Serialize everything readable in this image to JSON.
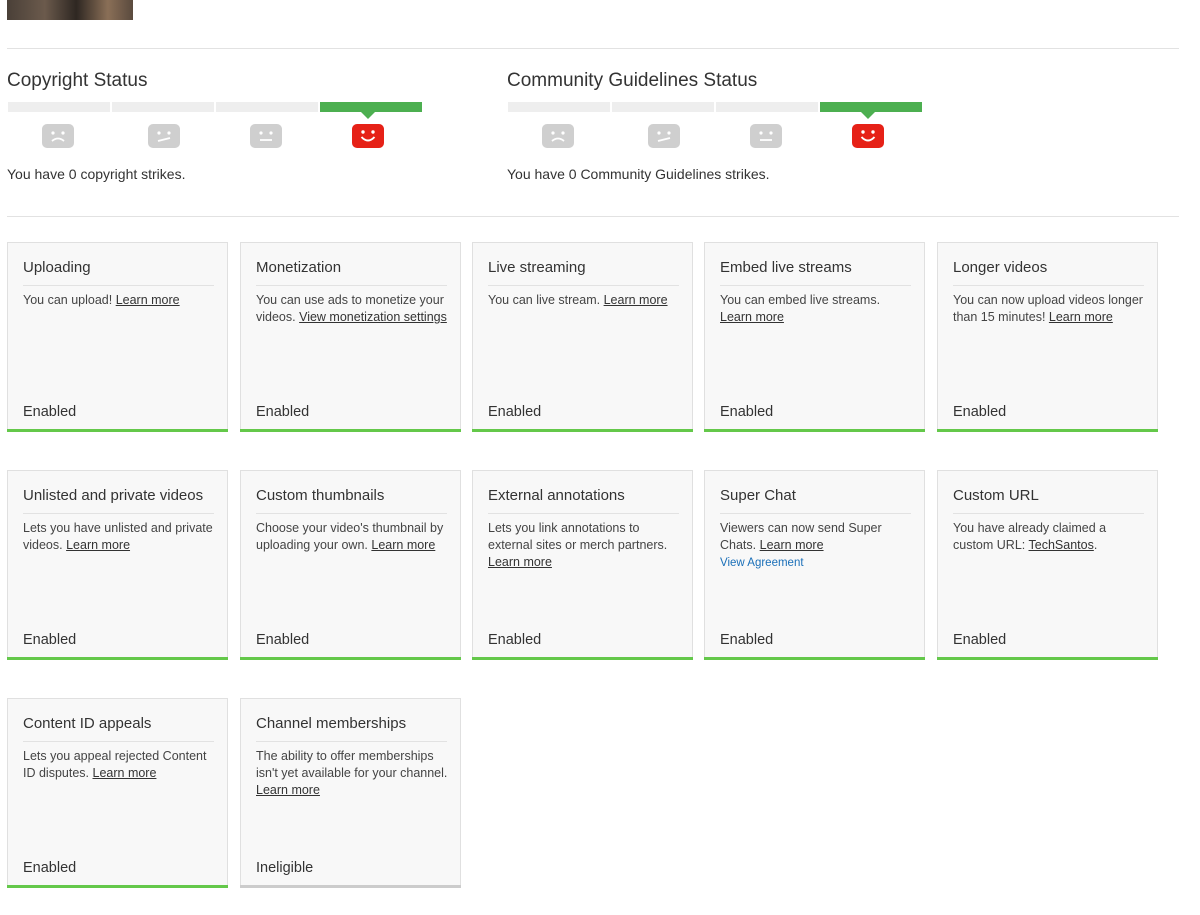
{
  "copyright": {
    "title": "Copyright Status",
    "strikes_text": "You have 0 copyright strikes."
  },
  "community": {
    "title": "Community Guidelines Status",
    "strikes_text": "You have 0 Community Guidelines strikes."
  },
  "colors": {
    "enabled_bar": "#64c84a",
    "ineligible_bar": "#cccccc",
    "active_segment": "#4caf50",
    "happy_face": "#e62117"
  },
  "features": [
    {
      "title": "Uploading",
      "desc": "You can upload!",
      "link": "Learn more",
      "status": "Enabled"
    },
    {
      "title": "Monetization",
      "desc": "You can use ads to monetize your videos.",
      "link": "View monetization settings",
      "status": "Enabled"
    },
    {
      "title": "Live streaming",
      "desc": "You can live stream.",
      "link": "Learn more",
      "status": "Enabled"
    },
    {
      "title": "Embed live streams",
      "desc": "You can embed live streams.",
      "link": "Learn more",
      "status": "Enabled"
    },
    {
      "title": "Longer videos",
      "desc": "You can now upload videos longer than 15 minutes!",
      "link": "Learn more",
      "status": "Enabled"
    },
    {
      "title": "Unlisted and private videos",
      "desc": "Lets you have unlisted and private videos.",
      "link": "Learn more",
      "status": "Enabled"
    },
    {
      "title": "Custom thumbnails",
      "desc": "Choose your video's thumbnail by uploading your own.",
      "link": "Learn more",
      "status": "Enabled"
    },
    {
      "title": "External annotations",
      "desc": "Lets you link annotations to external sites or merch partners.",
      "link": "Learn more",
      "status": "Enabled"
    },
    {
      "title": "Super Chat",
      "desc": "Viewers can now send Super Chats.",
      "link": "Learn more",
      "extra_link": "View Agreement",
      "status": "Enabled"
    },
    {
      "title": "Custom URL",
      "desc": "You have already claimed a custom URL:",
      "link": "TechSantos",
      "suffix": ".",
      "status": "Enabled"
    },
    {
      "title": "Content ID appeals",
      "desc": "Lets you appeal rejected Content ID disputes.",
      "link": "Learn more",
      "status": "Enabled"
    },
    {
      "title": "Channel memberships",
      "desc": "The ability to offer memberships isn't yet available for your channel.",
      "link": "Learn more",
      "status": "Ineligible"
    }
  ]
}
